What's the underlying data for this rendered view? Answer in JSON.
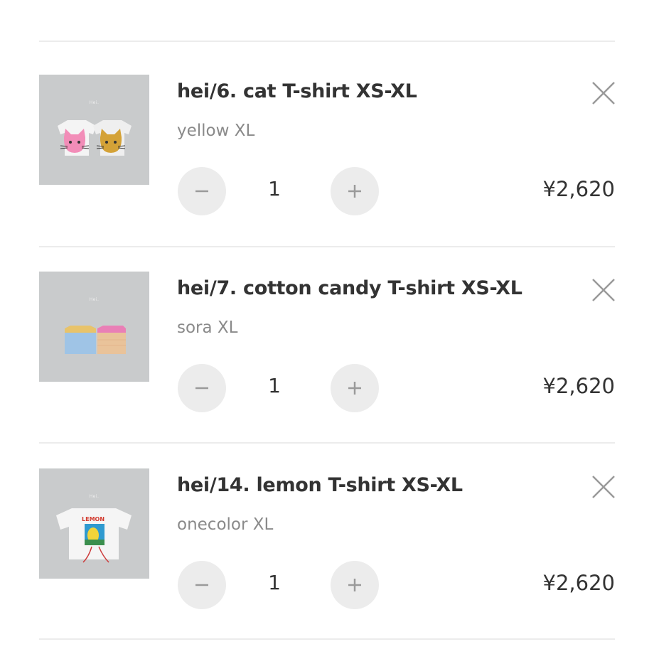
{
  "cart": {
    "items": [
      {
        "title": "hei/6. cat T-shirt XS-XL",
        "variant": "yellow XL",
        "quantity": "1",
        "price": "¥2,620",
        "image_brand": "Hei.",
        "remove_icon": "close-icon",
        "minus_icon": "minus-icon",
        "plus_icon": "plus-icon"
      },
      {
        "title": "hei/7. cotton candy T-shirt XS-XL",
        "variant": "sora XL",
        "quantity": "1",
        "price": "¥2,620",
        "image_brand": "Hei.",
        "remove_icon": "close-icon",
        "minus_icon": "minus-icon",
        "plus_icon": "plus-icon"
      },
      {
        "title": "hei/14. lemon T-shirt XS-XL",
        "variant": "onecolor XL",
        "quantity": "1",
        "price": "¥2,620",
        "image_brand": "Hei.",
        "image_print": "LEMON",
        "remove_icon": "close-icon",
        "minus_icon": "minus-icon",
        "plus_icon": "plus-icon"
      }
    ]
  },
  "colors": {
    "divider": "#ececec",
    "stepper_bg": "#ececec",
    "title": "#333333",
    "variant": "#8a8a8a",
    "icon": "#9a9a9a"
  }
}
